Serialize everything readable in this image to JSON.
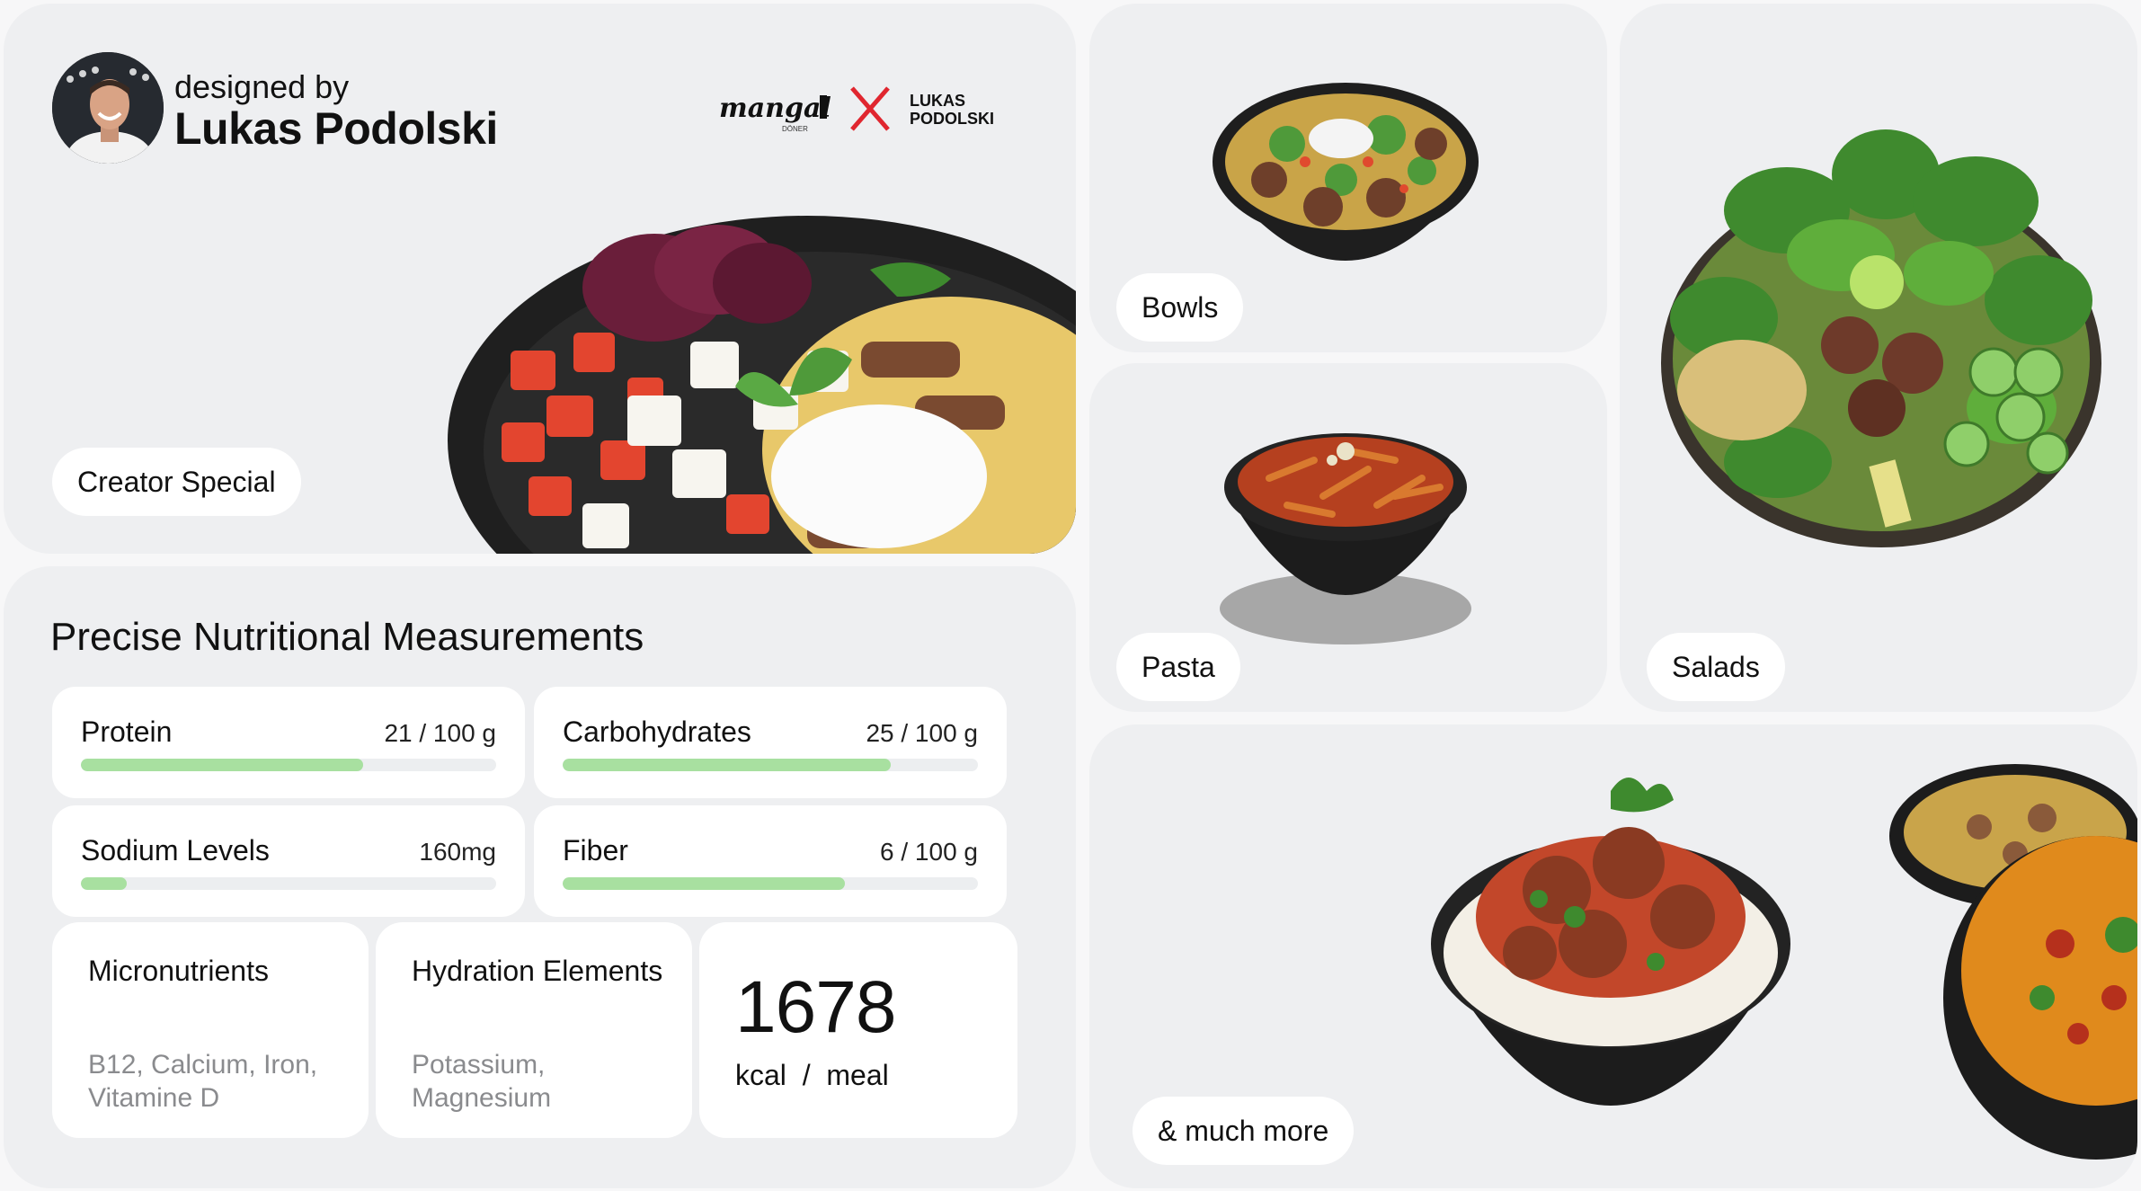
{
  "creator": {
    "designed_by": "designed by",
    "name": "Lukas Podolski",
    "brand_left": "mangal",
    "brand_sub": "DÖNER",
    "brand_right_top": "LUKAS",
    "brand_right_bottom": "PODOLSKI",
    "tag": "Creator Special"
  },
  "nutrition": {
    "title": "Precise Nutritional Measurements",
    "metrics": [
      {
        "name": "Protein",
        "value": "21 / 100 g",
        "fill": 0.68
      },
      {
        "name": "Carbohydrates",
        "value": "25 / 100 g",
        "fill": 0.79
      },
      {
        "name": "Sodium Levels",
        "value": "160mg",
        "fill": 0.11
      },
      {
        "name": "Fiber",
        "value": "6 / 100 g",
        "fill": 0.68
      }
    ],
    "micronutrients": {
      "title": "Micronutrients",
      "desc": "B12, Calcium, Iron, Vitamine D"
    },
    "hydration": {
      "title": "Hydration Elements",
      "desc": "Potassium, Magnesium"
    },
    "energy": {
      "value": "1678",
      "unit": "kcal  /  meal"
    }
  },
  "categories": {
    "bowls": "Bowls",
    "pasta": "Pasta",
    "salads": "Salads",
    "more": "& much more"
  },
  "colors": {
    "card_bg": "#eeeff1",
    "bar_fill": "#a8e0a0",
    "bar_track": "#eceef0",
    "logo_red": "#e0262f"
  }
}
